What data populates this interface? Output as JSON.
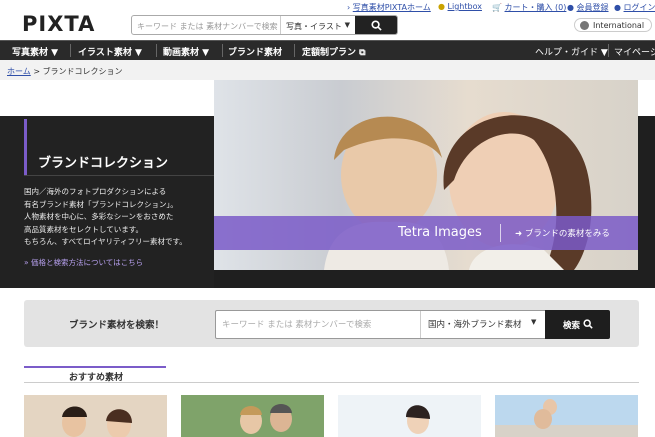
{
  "header": {
    "logo": "PIXTA",
    "search": {
      "placeholder": "キーワード または 素材ナンバーで検索",
      "category": "写真・イラスト"
    },
    "links": {
      "home": "写真素材PIXTAホーム",
      "lightbox": "Lightbox",
      "cart": "カート・購入 (0)",
      "register": "会員登録",
      "login": "ログイン"
    },
    "international": "International"
  },
  "nav": {
    "items": [
      "写真素材",
      "イラスト素材",
      "動画素材",
      "ブランド素材",
      "定額制プラン"
    ],
    "right": [
      "ヘルプ・ガイド",
      "マイページ"
    ]
  },
  "breadcrumb": {
    "home": "ホーム",
    "sep": ">",
    "current": "ブランドコレクション"
  },
  "hero": {
    "title": "ブランドコレクション",
    "desc": [
      "国内／海外のフォトプロダクションによる",
      "有名ブランド素材「ブランドコレクション」。",
      "人物素材を中心に、多彩なシーンをおさめた",
      "高品質素材をセレクトしています。",
      "もちろん、すべてロイヤリティフリー素材です。"
    ],
    "link": "» 価格と検索方法についてはこちら",
    "brand": "Tetra Images",
    "cta": "ブランドの素材をみる"
  },
  "brand_search": {
    "label": "ブランド素材を検索！",
    "placeholder": "キーワード または 素材ナンバーで検索",
    "category": "国内・海外ブランド素材",
    "button": "検索"
  },
  "recommend": {
    "title": "おすすめ素材"
  },
  "colors": {
    "accent": "#7b5cc9",
    "dark": "#222222",
    "link": "#2f4fa8"
  }
}
